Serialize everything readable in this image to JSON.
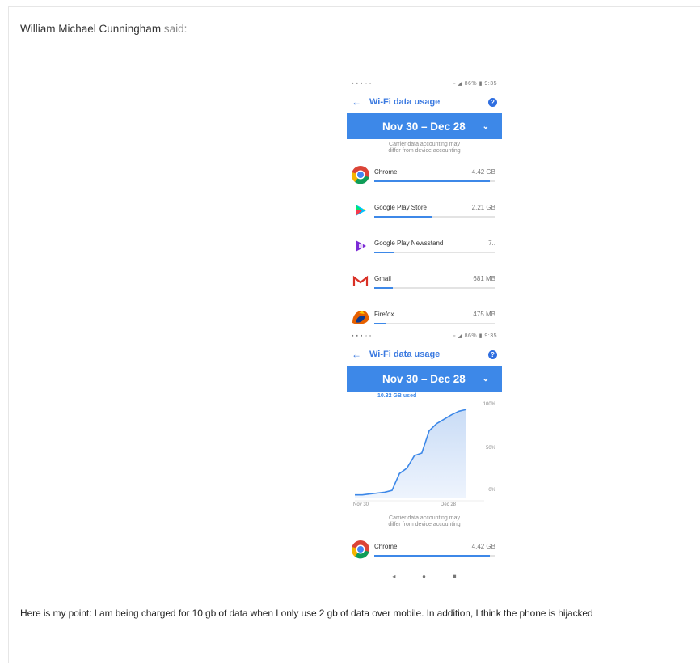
{
  "post": {
    "author": "William Michael Cunningham",
    "said": "said:",
    "text": "Here is my point: I am being charged for 10 gb of data when I only use 2 gb of data over mobile. In addition, I think the phone is hijacked"
  },
  "screen1": {
    "status_left": "▪ ▪ ▪ ▫ ▫",
    "status_right": "▫ ◢ 86% ▮ 9:35",
    "title": "Wi-Fi data usage",
    "cycle": "Nov 30 – Dec 28",
    "note": "Carrier data accounting may differ from device accounting",
    "apps": [
      {
        "name": "Chrome",
        "size": "4.42 GB",
        "fill": 0.95,
        "icon": "chrome-icon"
      },
      {
        "name": "Google Play Store",
        "size": "2.21 GB",
        "fill": 0.48,
        "icon": "play-store-icon"
      },
      {
        "name": "Google Play Newsstand",
        "size": "7..",
        "fill": 0.16,
        "icon": "newsstand-icon"
      },
      {
        "name": "Gmail",
        "size": "681 MB",
        "fill": 0.15,
        "icon": "gmail-icon"
      },
      {
        "name": "Firefox",
        "size": "475 MB",
        "fill": 0.1,
        "icon": "firefox-icon"
      }
    ]
  },
  "screen2": {
    "status_left": "▪ ▪ ▪ ▫ ▫",
    "status_right": "▫ ◢ 86% ▮ 9:35",
    "title": "Wi-Fi data usage",
    "cycle": "Nov 30 – Dec 28",
    "used": "10.32 GB used",
    "y_labels": [
      "100%",
      "50%",
      "0%"
    ],
    "x_labels": [
      "Nov 30",
      "Dec 28"
    ],
    "note": "Carrier data accounting may differ from device accounting",
    "app": {
      "name": "Chrome",
      "size": "4.42 GB",
      "fill": 0.95,
      "icon": "chrome-icon"
    }
  },
  "colors": {
    "accent": "#3d88e8",
    "link_title": "#3a79e0"
  },
  "chart_data": {
    "type": "area",
    "x_labels": [
      "Nov 30",
      "Dec 28"
    ],
    "y_labels": [
      "0%",
      "50%",
      "100%"
    ],
    "ylim": [
      0,
      100
    ],
    "series": [
      {
        "values": [
          3,
          3,
          4,
          5,
          6,
          8,
          27,
          33,
          47,
          50,
          75,
          83,
          88,
          93,
          97,
          99
        ]
      }
    ]
  }
}
